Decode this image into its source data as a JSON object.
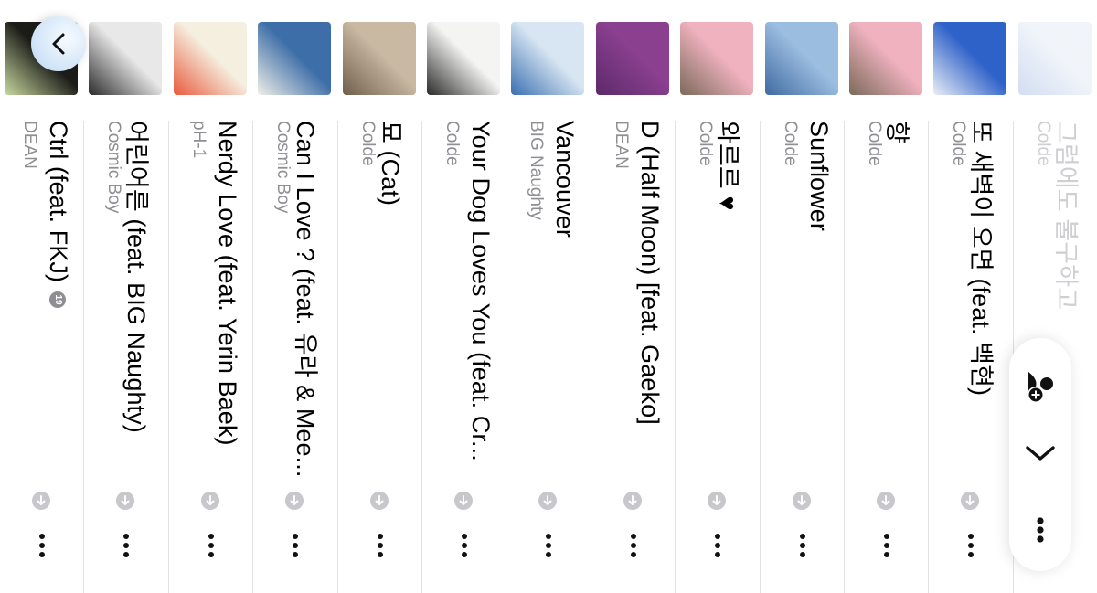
{
  "pill": {
    "add_person_icon": "person-add-icon",
    "collapse_icon": "chevron-right-icon",
    "more_icon": "ellipsis-icon"
  },
  "fab": {
    "icon": "chevron-down-icon"
  },
  "songs": [
    {
      "title": "그럼에도 불구하고",
      "artist": "Colde",
      "faded": true,
      "art_colors": [
        "#dfe8f5",
        "#9cb4e0"
      ]
    },
    {
      "title": "또 새벽이 오면 (feat. 백현)",
      "artist": "Colde",
      "art_colors": [
        "#2f62c8",
        "#e9eef6"
      ]
    },
    {
      "title": "향",
      "artist": "Colde",
      "art_colors": [
        "#f0b2bf",
        "#7b6a5a"
      ]
    },
    {
      "title": "Sunflower",
      "artist": "Colde",
      "art_colors": [
        "#9bbde0",
        "#3f6aa2"
      ]
    },
    {
      "title": "와르르 ♥",
      "artist": "Colde",
      "art_colors": [
        "#f0b2bf",
        "#7b6a5a"
      ]
    },
    {
      "title": "D (Half Moon) [feat. Gaeko]",
      "artist": "DEAN",
      "art_colors": [
        "#8a3f8f",
        "#5c2a6a"
      ]
    },
    {
      "title": "Vancouver",
      "artist": "BIG Naughty",
      "art_colors": [
        "#d8e6f3",
        "#3a6fb0"
      ]
    },
    {
      "title": "Your Dog Loves You (feat. Cr...",
      "artist": "Colde",
      "art_colors": [
        "#f4f4f2",
        "#2a2a2a"
      ]
    },
    {
      "title": "묘 (Cat)",
      "artist": "Colde",
      "art_colors": [
        "#c9b9a3",
        "#6f5f4d"
      ]
    },
    {
      "title": "Can I Love ? (feat. 유라 & Mee...",
      "artist": "Cosmic Boy",
      "art_colors": [
        "#3d6ea8",
        "#f0efe8"
      ]
    },
    {
      "title": "Nerdy Love (feat. Yerin Baek)",
      "artist": "pH-1",
      "art_colors": [
        "#f5efe0",
        "#e85a3c"
      ]
    },
    {
      "title": "어린어른 (feat. BIG Naughty)",
      "artist": "Cosmic Boy",
      "art_colors": [
        "#e8e8e8",
        "#2b2b2b"
      ]
    },
    {
      "title": "Ctrl (feat. FKJ)",
      "artist": "DEAN",
      "badge": "19",
      "art_colors": [
        "#1c1c18",
        "#c8d9a0"
      ]
    }
  ]
}
